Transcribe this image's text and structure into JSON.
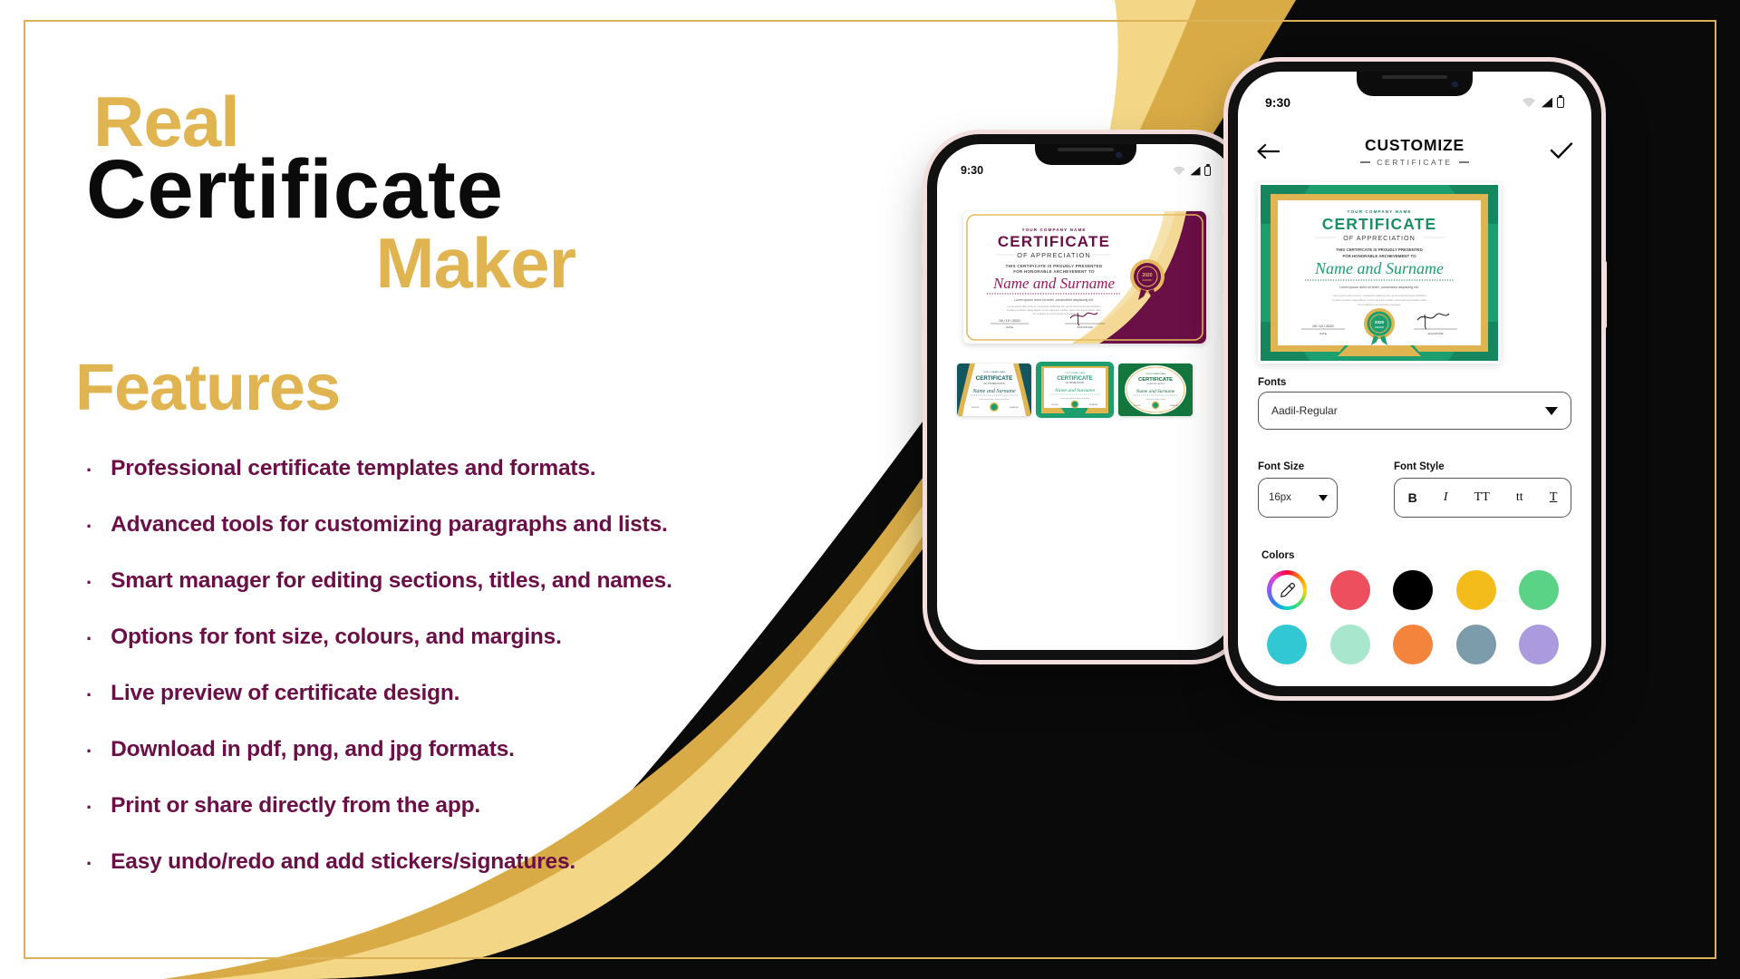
{
  "hero": {
    "line1": "Real",
    "line2": "Certificate",
    "line3": "Maker",
    "features_heading": "Features"
  },
  "features": [
    "Professional certificate templates and formats.",
    "Advanced tools for customizing paragraphs and lists.",
    "Smart manager for editing sections, titles, and names.",
    "Options for font size, colours, and margins.",
    "Live preview of certificate design.",
    "Download in pdf, png, and jpg formats.",
    "Print or share directly from the app.",
    "Easy undo/redo and add stickers/signatures."
  ],
  "bullet_glyph": "·",
  "colors": {
    "gold": "#e0b450",
    "gold_dark": "#d2a23f",
    "gold_light": "#f2d98a",
    "maroon": "#6b0f47",
    "black": "#0a0a0a",
    "white": "#ffffff",
    "phone_frame": "#f2dedd"
  },
  "phone_left": {
    "status": {
      "time": "9:30",
      "wifi_icon": "wifi-icon",
      "signal_icon": "signal-icon",
      "battery_icon": "battery-icon"
    },
    "main_certificate": {
      "company": "YOUR COMPANY NAME",
      "title": "CERTIFICATE",
      "subtitle": "OF APPRECIATION",
      "presented_line1": "THIS CERTIFICATE IS PROUDLY PRESENTED",
      "presented_line2": "FOR HONORABLE ARCHEVEMENT TO",
      "recipient": "Name and Surname",
      "lorem": "Lorem ipsum dolor sit amet, consectetur adipiscing elit.",
      "date": "09 / 10 / 2020",
      "date_label": "DATE",
      "signature_label": "SIGNATURE",
      "badge_year": "2020",
      "badge_text": "AWARD",
      "theme": "maroon-gold"
    },
    "templates": [
      {
        "name": "template-teal-gold",
        "theme": "teal",
        "selected": false
      },
      {
        "name": "template-green-gold",
        "theme": "green",
        "selected": true
      },
      {
        "name": "template-dark-green",
        "theme": "darkgreen",
        "selected": false
      }
    ]
  },
  "phone_right": {
    "status": {
      "time": "9:30",
      "wifi_icon": "wifi-icon",
      "signal_icon": "signal-icon",
      "battery_icon": "battery-icon"
    },
    "appbar": {
      "back_icon": "arrow-left-icon",
      "title": "CUSTOMIZE",
      "subtitle": "CERTIFICATE",
      "confirm_icon": "check-icon"
    },
    "preview_certificate": {
      "company": "YOUR COMPANY NAME",
      "title": "CERTIFICATE",
      "subtitle": "OF APPRECIATION",
      "presented_line1": "THIS CERTIFICATE IS PROUDLY PRESENTED",
      "presented_line2": "FOR HONORABLE ARCHEVEMENT TO",
      "recipient": "Name and Surname",
      "lorem": "Lorem ipsum dolor sit amet, consectetur adipiscing elit.",
      "date": "09 / 10 / 2020",
      "date_label": "DATE",
      "signature_label": "SIGNATURE",
      "badge_year": "2020",
      "badge_text": "AWARD",
      "theme": "green-gold"
    },
    "controls": {
      "fonts_label": "Fonts",
      "font_value": "Aadil-Regular",
      "font_size_label": "Font Size",
      "font_size_value": "16px",
      "font_style_label": "Font Style",
      "style_buttons": [
        {
          "name": "bold-button",
          "glyph": "B"
        },
        {
          "name": "italic-button",
          "glyph": "I"
        },
        {
          "name": "uppercase-button",
          "glyph": "TT"
        },
        {
          "name": "lowercase-button",
          "glyph": "tt"
        },
        {
          "name": "underline-button",
          "glyph": "T"
        }
      ],
      "colors_label": "Colors",
      "swatches": [
        {
          "name": "color-picker",
          "hex": "eyedropper"
        },
        {
          "name": "swatch-red",
          "hex": "#ee4f5e"
        },
        {
          "name": "swatch-black",
          "hex": "#000000"
        },
        {
          "name": "swatch-amber",
          "hex": "#f4bc1a"
        },
        {
          "name": "swatch-green",
          "hex": "#5bd387"
        },
        {
          "name": "swatch-cyan",
          "hex": "#31c8d4"
        },
        {
          "name": "swatch-mint",
          "hex": "#a8e7ce"
        },
        {
          "name": "swatch-orange",
          "hex": "#f4833c"
        },
        {
          "name": "swatch-slate",
          "hex": "#7c9bab"
        },
        {
          "name": "swatch-purple",
          "hex": "#ab9ade"
        }
      ]
    }
  }
}
